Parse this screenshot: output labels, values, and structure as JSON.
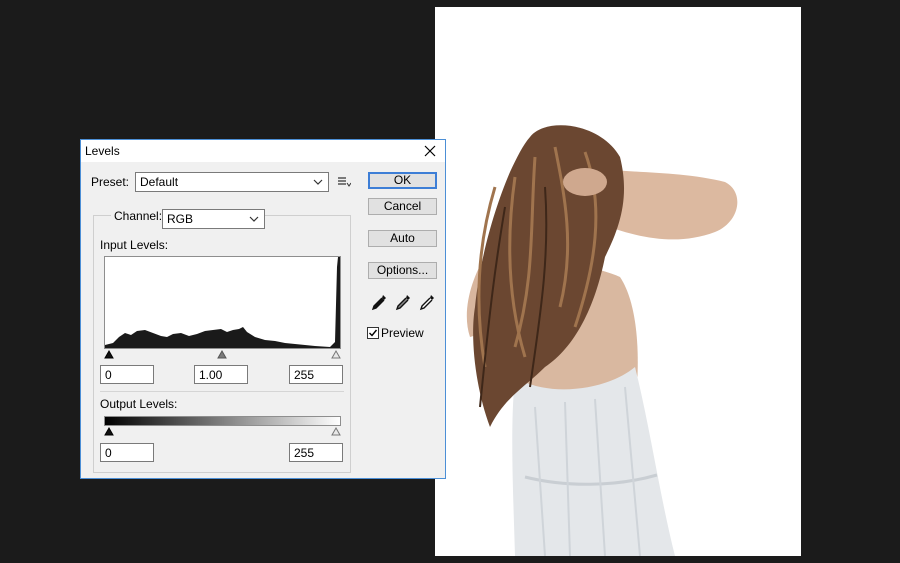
{
  "dialog": {
    "title": "Levels",
    "preset_label": "Preset:",
    "preset_value": "Default",
    "channel_label": "Channel:",
    "channel_value": "RGB",
    "input_levels_label": "Input Levels:",
    "output_levels_label": "Output Levels:",
    "input_black": "0",
    "input_gamma": "1.00",
    "input_white": "255",
    "output_black": "0",
    "output_white": "255",
    "buttons": {
      "ok": "OK",
      "cancel": "Cancel",
      "auto": "Auto",
      "options": "Options..."
    },
    "preview_label": "Preview",
    "preview_checked": true
  },
  "icons": [
    "close-icon",
    "chevron-down-icon",
    "preset-options-icon",
    "black-eyedropper-icon",
    "gray-eyedropper-icon",
    "white-eyedropper-icon"
  ],
  "colors": {
    "app_background": "#1b1b1b",
    "dialog_background": "#f0f0f0",
    "accent": "#3d7ed6",
    "histogram": "#1a1a1a"
  }
}
